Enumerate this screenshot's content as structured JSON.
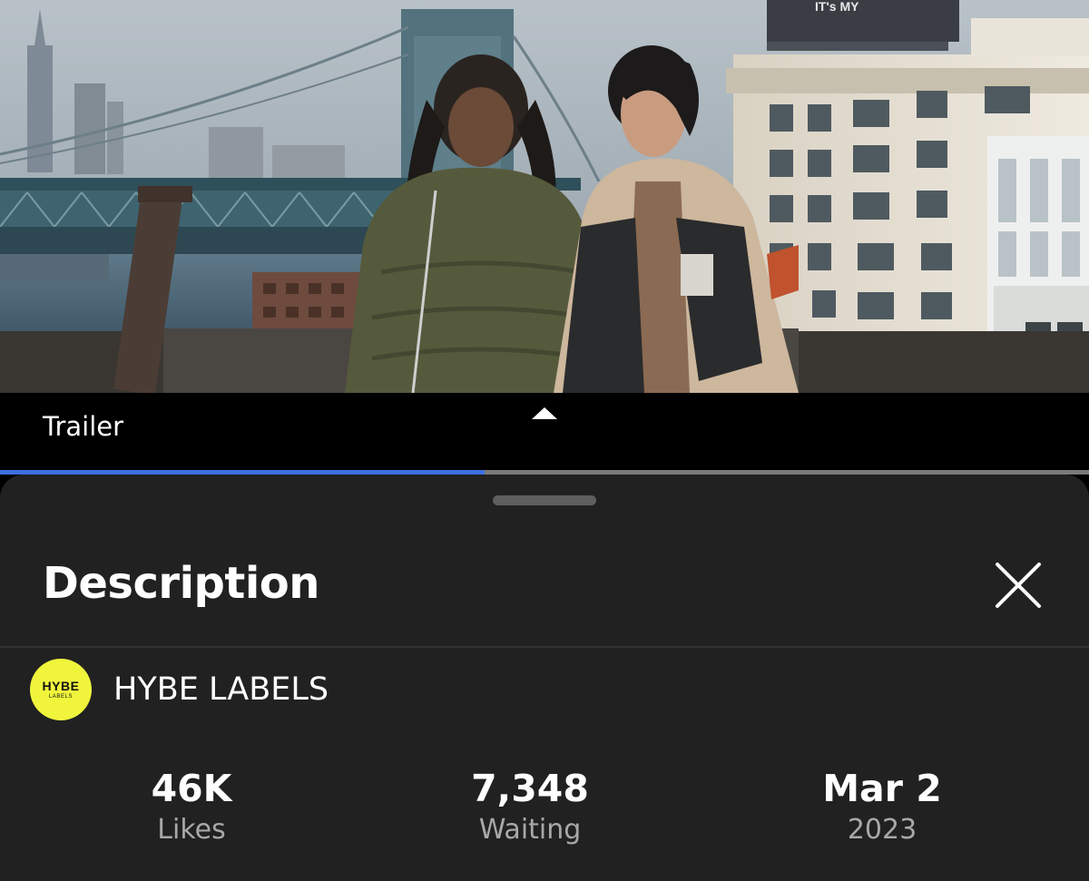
{
  "video": {
    "label": "Trailer",
    "billboard_text": "IT's MY",
    "progress_fraction": 0.445
  },
  "sheet": {
    "title": "Description",
    "close_icon": "close-icon"
  },
  "channel": {
    "name": "HYBE LABELS",
    "avatar_text": "HYBE",
    "avatar_subtext": "LABELS",
    "avatar_color": "#f0f53c"
  },
  "stats": [
    {
      "value": "46K",
      "label": "Likes"
    },
    {
      "value": "7,348",
      "label": "Waiting"
    },
    {
      "value": "Mar 2",
      "label": "2023"
    }
  ],
  "colors": {
    "progress": "#3d6fe0",
    "sheet_bg": "#212121"
  }
}
